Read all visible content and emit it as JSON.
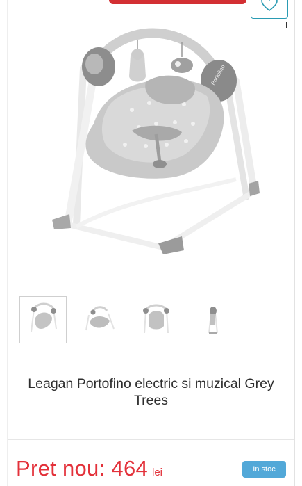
{
  "product": {
    "title": "Leagan Portofino electric si muzical Grey Trees",
    "price_label": "Pret nou: 464",
    "currency": "lei",
    "stock_status": "In stoc",
    "image_brand_text": "Portofino"
  },
  "gallery": {
    "thumbnail_count": 4,
    "active_index": 0
  },
  "icons": {
    "wishlist": "heart-icon"
  },
  "colors": {
    "price": "#e3313a",
    "stock_badge": "#52a8d8",
    "wishlist_border": "#2a9bb3",
    "top_bar": "#d32f33"
  }
}
